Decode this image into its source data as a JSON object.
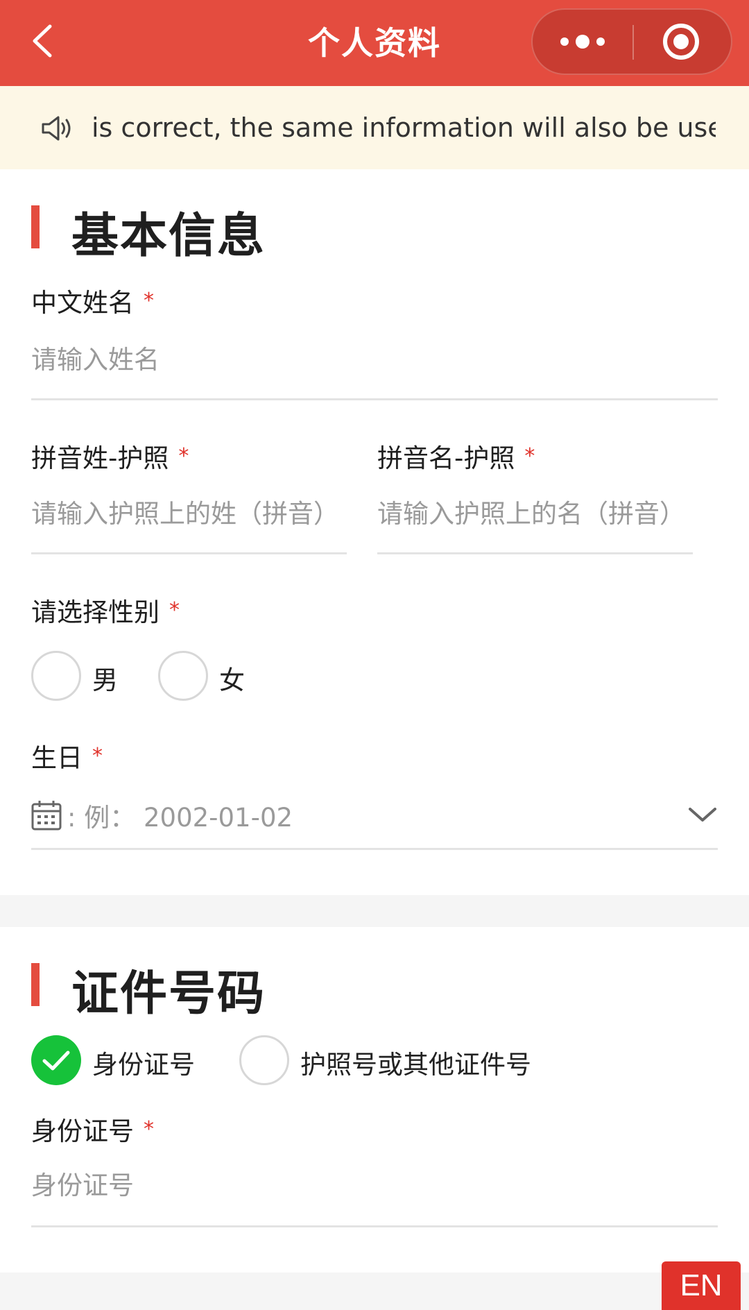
{
  "header": {
    "title": "个人资料",
    "back_icon": "chevron-left-icon",
    "more_icon": "more-dots-icon",
    "record_icon": "record-target-icon"
  },
  "notice": {
    "icon": "speaker-icon",
    "text": "is correct, the same information will also be used to"
  },
  "basic_info": {
    "title": "基本信息",
    "chinese_name": {
      "label": "中文姓名",
      "required": "*",
      "placeholder": "请输入姓名"
    },
    "pinyin_surname": {
      "label": "拼音姓-护照",
      "required": "*",
      "placeholder": "请输入护照上的姓（拼音）"
    },
    "pinyin_given": {
      "label": "拼音名-护照",
      "required": "*",
      "placeholder": "请输入护照上的名（拼音）"
    },
    "gender": {
      "label": "请选择性别",
      "required": "*",
      "options": [
        "男",
        "女"
      ],
      "selected": null
    },
    "birthday": {
      "label": "生日",
      "required": "*",
      "prefix": ":",
      "placeholder": "例：  2002-01-02",
      "icon": "calendar-icon"
    }
  },
  "id_section": {
    "title": "证件号码",
    "id_types": [
      "身份证号",
      "护照号或其他证件号"
    ],
    "selected_type": "身份证号",
    "id_number": {
      "label": "身份证号",
      "required": "*",
      "placeholder": "身份证号"
    }
  },
  "language_toggle": "EN",
  "colors": {
    "accent": "#e44c3f",
    "required": "#e0322b",
    "checked": "#16c23a",
    "notice_bg": "#fdf7e6",
    "placeholder": "#9a9a9a"
  }
}
